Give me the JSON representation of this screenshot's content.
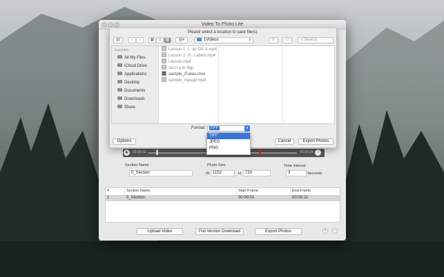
{
  "window": {
    "title": "Video To Photo Lite"
  },
  "save_sheet": {
    "message": "Please select a location to save file(s).",
    "path": "1Videos",
    "search_placeholder": "Search",
    "sidebar_heading": "Favorites",
    "sidebar_items": [
      {
        "label": "All My Files",
        "icon": "all-files-icon"
      },
      {
        "label": "iCloud Drive",
        "icon": "cloud-icon"
      },
      {
        "label": "Applications",
        "icon": "applications-icon"
      },
      {
        "label": "Desktop",
        "icon": "desktop-icon"
      },
      {
        "label": "Documents",
        "icon": "documents-icon"
      },
      {
        "label": "Downloads",
        "icon": "downloads-icon"
      },
      {
        "label": "Share",
        "icon": "folder-icon"
      }
    ],
    "files": [
      {
        "name": "Lesson 1. I...ac OS X.mp4",
        "dark": false
      },
      {
        "name": "Lesson 2. H...Labels.mp4",
        "dark": false
      },
      {
        "name": "Lesson.mp4",
        "dark": false
      },
      {
        "name": "sa m p le.3gp",
        "dark": false
      },
      {
        "name": "sample_iTunes.mov",
        "dark": true
      },
      {
        "name": "sample_mpeg4.mp4",
        "dark": false
      }
    ],
    "format_label": "Format:",
    "format_value": "TIFF",
    "format_options": [
      "TIFF",
      "JPEG",
      "PNG"
    ],
    "options_label": "Options",
    "cancel_label": "Cancel",
    "export_label": "Export Photos"
  },
  "player": {
    "time_start": "00:00:22",
    "time_end": "00:00:24"
  },
  "settings": {
    "section_name_label": "Section Name",
    "section_name_value": "0_Section",
    "photo_size_label": "Photo Size",
    "w_label": "W",
    "w_value": "1152",
    "h_label": "H",
    "h_value": "720",
    "interval_label": "Time Interval",
    "interval_value": "3",
    "interval_unit": "Seconds"
  },
  "table": {
    "headers": [
      "#",
      "Section Name",
      "Start Frame",
      "End Frame"
    ],
    "rows": [
      {
        "num": "1",
        "name": "0_Section",
        "start": "00:00:01",
        "end": "00:00:22"
      }
    ]
  },
  "bottom": {
    "upload_label": "Upload Video",
    "full_label": "Full Version Download",
    "export_label": "Export Photos",
    "add_symbol": "+",
    "remove_symbol": "−"
  }
}
